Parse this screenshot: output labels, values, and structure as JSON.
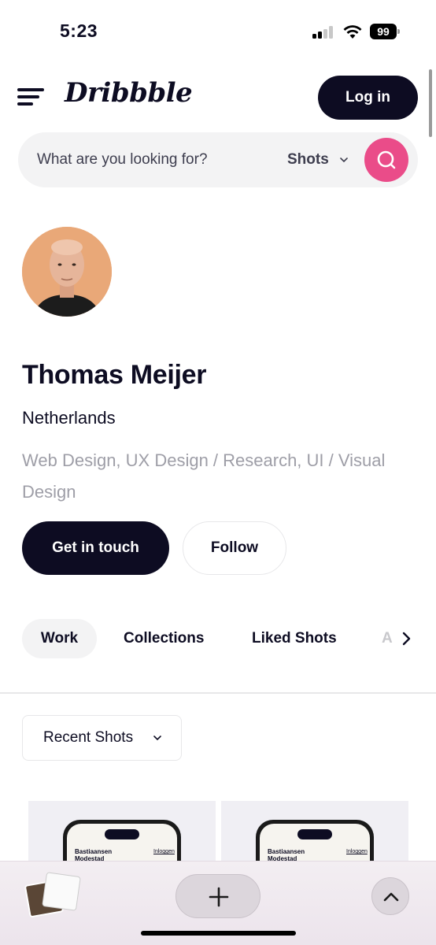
{
  "status_bar": {
    "time": "5:23",
    "battery": "99",
    "icons": [
      "cellular-signal-icon",
      "wifi-icon",
      "battery-icon"
    ]
  },
  "header": {
    "logo": "Dribbble",
    "login_label": "Log in",
    "menu_icon": "hamburger-menu-icon"
  },
  "search": {
    "placeholder": "What are you looking for?",
    "type_label": "Shots",
    "search_icon": "search-icon",
    "accent_color": "#ea4c89"
  },
  "profile": {
    "name": "Thomas Meijer",
    "location": "Netherlands",
    "skills": "Web Design, UX Design / Research, UI / Visual Design",
    "contact_label": "Get in touch",
    "follow_label": "Follow"
  },
  "tabs": {
    "items": [
      {
        "label": "Work",
        "active": true
      },
      {
        "label": "Collections",
        "active": false
      },
      {
        "label": "Liked Shots",
        "active": false
      },
      {
        "label": "A",
        "active": false
      }
    ],
    "next_icon": "chevron-right-icon"
  },
  "filter": {
    "selected": "Recent Shots"
  },
  "shots": [
    {
      "brand_line1": "Bastiaansen",
      "brand_line2": "Modestad",
      "link": "Inloggen"
    },
    {
      "brand_line1": "Bastiaansen",
      "brand_line2": "Modestad",
      "link": "Inloggen"
    }
  ],
  "browser_bar": {
    "icons": [
      "tab-overview-icon",
      "plus-icon",
      "chevron-up-icon"
    ]
  },
  "colors": {
    "primary_dark": "#0d0c22",
    "muted_text": "#9e9ea7",
    "surface": "#f3f3f4"
  }
}
